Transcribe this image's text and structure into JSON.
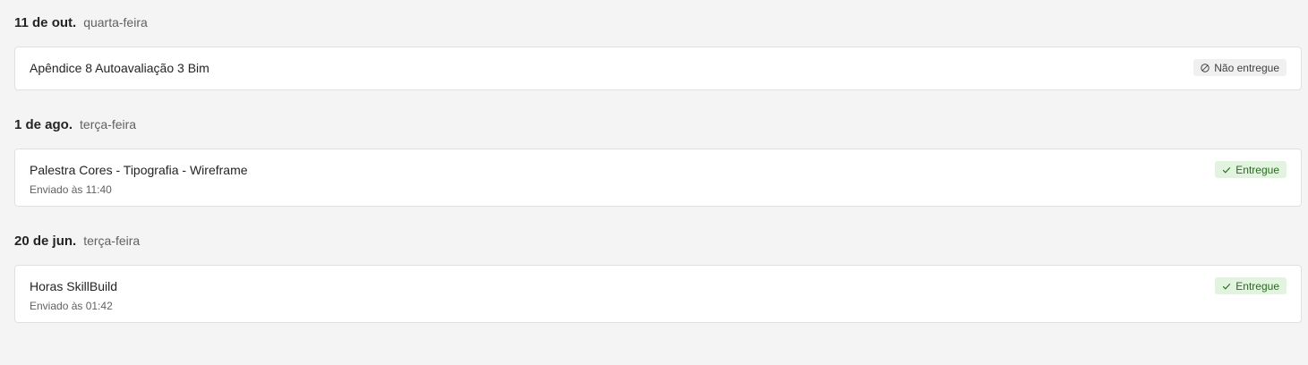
{
  "groups": [
    {
      "date": "11 de out.",
      "weekday": "quarta-feira",
      "assignments": [
        {
          "title": "Apêndice 8 Autoavaliação 3 Bim",
          "status": "Não entregue",
          "status_icon": "blocked-circle-icon"
        }
      ]
    },
    {
      "date": "1 de ago.",
      "weekday": "terça-feira",
      "assignments": [
        {
          "title": "Palestra Cores - Tipografia - Wireframe",
          "submitted": "Enviado às 11:40",
          "status": "Entregue",
          "status_icon": "checkmark-icon"
        }
      ]
    },
    {
      "date": "20 de jun.",
      "weekday": "terça-feira",
      "assignments": [
        {
          "title": "Horas SkillBuild",
          "submitted": "Enviado às 01:42",
          "status": "Entregue",
          "status_icon": "checkmark-icon"
        }
      ]
    }
  ],
  "colors": {
    "background": "#f4f4f4",
    "card": "#ffffff",
    "success_bg": "#e2f3df",
    "success_text": "#276b1e",
    "neutral_bg": "#f0f0f0"
  }
}
